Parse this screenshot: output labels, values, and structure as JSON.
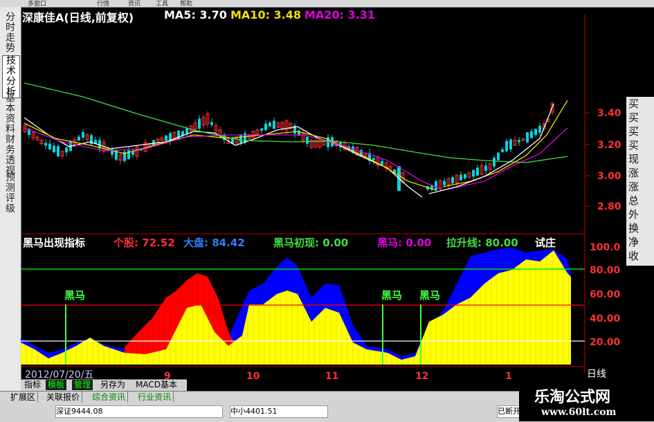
{
  "menu": [
    "多窗口",
    "行情",
    "资讯",
    "工具",
    "帮助"
  ],
  "left_tabs": [
    {
      "label": "分时走势",
      "active": false
    },
    {
      "label": "技术分析",
      "active": true
    },
    {
      "label": "基本资料",
      "active": false
    },
    {
      "label": "财务透视",
      "active": false
    },
    {
      "label": "预测评级",
      "active": false
    }
  ],
  "title": {
    "stock": "深康佳A(日线,前复权)",
    "ma5": "MA5: 3.70",
    "ma10": "MA10: 3.48",
    "ma20": "MA20: 3.31"
  },
  "price_axis": [
    "3.40",
    "3.20",
    "3.00",
    "2.80"
  ],
  "indicator": {
    "name": "黑马出现指标",
    "geshu": "个股: 72.52",
    "dapan": "大盘: 84.42",
    "chuxian": "黑马初现: 0.00",
    "heima": "黑马: 0.00",
    "lashengxian": "拉升线: 80.00",
    "shizhuang": "试庄",
    "axis": [
      "100.0",
      "80.00",
      "60.00",
      "40.00",
      "20.00"
    ],
    "marker_label": "黑马"
  },
  "time_axis": {
    "date": "2012/07/20/五",
    "months": [
      "9",
      "10",
      "11",
      "12",
      "1"
    ],
    "period": "日线"
  },
  "bottom_tabs": [
    "指标",
    "模板",
    "管理",
    "另存为",
    "MACD基本"
  ],
  "status_buttons": [
    "扩展区",
    "关联报价",
    "综合资讯",
    "行业资讯"
  ],
  "quotes": [
    "深证9444.08",
    "中小4401.51",
    "已断开"
  ],
  "right_tabs": [
    "买",
    "买",
    "买",
    "买",
    "现",
    "涨",
    "涨",
    "总",
    "外",
    "换",
    "净",
    "收"
  ],
  "watermark": {
    "cn": "乐淘公式网",
    "url": "www.60lt.com"
  },
  "colors": {
    "up": "#ff3030",
    "down": "#00d8e0",
    "ma5": "#ffffff",
    "ma10": "#f0e000",
    "ma20": "#e000e0",
    "ma60": "#40e040",
    "yellow": "#ffff00",
    "blue": "#0000ff",
    "red": "#ff0000"
  }
}
